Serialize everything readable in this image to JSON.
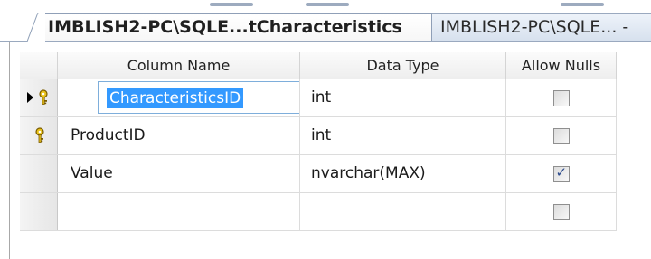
{
  "tabs": [
    {
      "label": "IMBLISH2-PC\\SQLE...tCharacteristics",
      "active": true
    },
    {
      "label": "IMBLISH2-PC\\SQLE... -",
      "active": false
    }
  ],
  "columns": {
    "headers": [
      "Column Name",
      "Data Type",
      "Allow Nulls"
    ],
    "rows": [
      {
        "name": "CharacteristicsID",
        "type": "int",
        "allow_nulls": false,
        "primary_key": true,
        "current": true
      },
      {
        "name": "ProductID",
        "type": "int",
        "allow_nulls": false,
        "primary_key": true,
        "current": false
      },
      {
        "name": "Value",
        "type": "nvarchar(MAX)",
        "allow_nulls": true,
        "primary_key": false,
        "current": false
      },
      {
        "name": "",
        "type": "",
        "allow_nulls": false,
        "primary_key": false,
        "current": false
      }
    ]
  },
  "icons": {
    "primary_key": "key-icon",
    "current_row": "row-pointer-icon",
    "checked": "checkmark-icon"
  },
  "colors": {
    "selection": "#3399ff",
    "tab_border": "#8f9fb7",
    "key_fill": "#e8c21a"
  }
}
